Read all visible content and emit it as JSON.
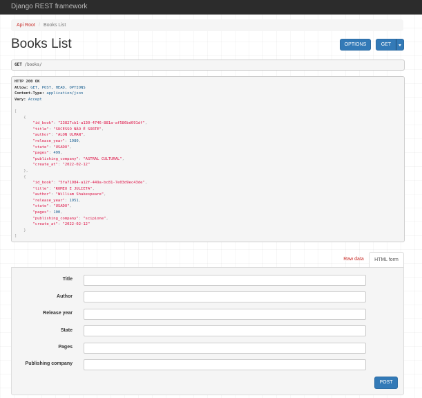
{
  "navbar": {
    "brand": "Django REST framework"
  },
  "breadcrumb": {
    "root": "Api Root",
    "separator": "/",
    "current": "Books List"
  },
  "page": {
    "title": "Books List"
  },
  "actions": {
    "options_label": "OPTIONS",
    "get_label": "GET"
  },
  "request": {
    "method": "GET",
    "path": "/books/"
  },
  "response": {
    "status": "HTTP 200 OK",
    "headers": [
      {
        "name": "Allow:",
        "value": "GET, POST, HEAD, OPTIONS"
      },
      {
        "name": "Content-Type:",
        "value": "application/json"
      },
      {
        "name": "Vary:",
        "value": "Accept"
      }
    ],
    "books": [
      {
        "id_book": "23827cb1-a130-4746-881a-af586bd091df",
        "title": "SUCESSO NÃO É SORTE",
        "author": "ALON ULMAN",
        "release_year": "1980",
        "state": "USADO",
        "pages": "499",
        "publishing_company": "ASTRAL CULTURAL",
        "create_at": "2022-02-12"
      },
      {
        "id_book": "5fa71984-a12f-449a-bc81-7e03d9ec43de",
        "title": "ROMEU E JULIETA",
        "author": "William Shakespeare",
        "release_year": "1951",
        "state": "USADO",
        "pages": "100",
        "publishing_company": "scipione",
        "create_at": "2022-02-12"
      }
    ]
  },
  "tabs": {
    "raw": "Raw data",
    "html": "HTML form"
  },
  "form": {
    "fields": [
      {
        "label": "Title",
        "value": ""
      },
      {
        "label": "Author",
        "value": ""
      },
      {
        "label": "Release year",
        "value": ""
      },
      {
        "label": "State",
        "value": ""
      },
      {
        "label": "Pages",
        "value": ""
      },
      {
        "label": "Publishing company",
        "value": ""
      }
    ],
    "submit_label": "POST"
  }
}
